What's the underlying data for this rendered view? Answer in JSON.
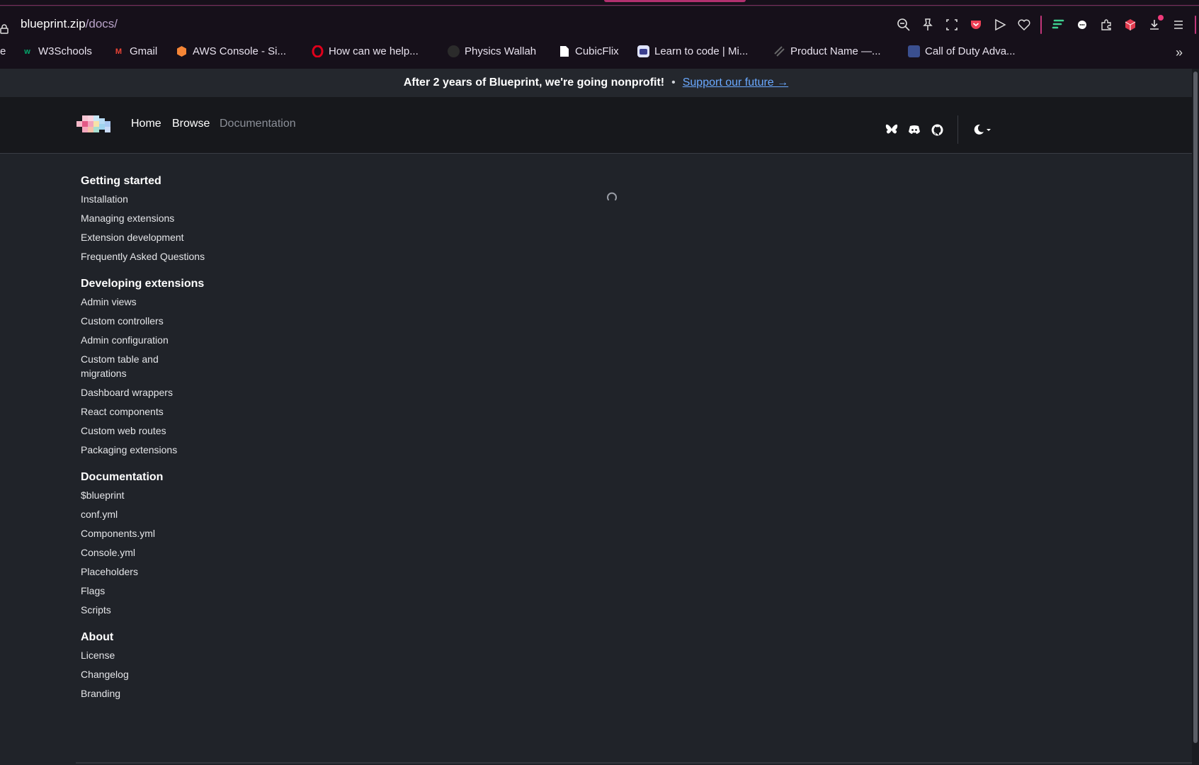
{
  "browser": {
    "url_host": "blueprint.zip",
    "url_path": "/docs/",
    "bookmarks": [
      {
        "label": "e",
        "icon": "none"
      },
      {
        "label": "W3Schools",
        "icon": "w3schools-icon",
        "color": "#04aa6d"
      },
      {
        "label": "Gmail",
        "icon": "gmail-icon",
        "color": "#ea4335"
      },
      {
        "label": "AWS Console - Si...",
        "icon": "aws-icon",
        "color": "#f58536"
      },
      {
        "label": "How can we help...",
        "icon": "opera-icon",
        "color": "#e0001b"
      },
      {
        "label": "Physics Wallah",
        "icon": "physics-wallah-icon",
        "color": "#333333"
      },
      {
        "label": "CubicFlix",
        "icon": "document-icon",
        "color": "#ffffff"
      },
      {
        "label": "Learn to code | Mi...",
        "icon": "mimo-icon",
        "color": "#e0e4ff"
      },
      {
        "label": "Product Name —...",
        "icon": "product-icon",
        "color": "#555555"
      },
      {
        "label": "Call of Duty Adva...",
        "icon": "cod-icon",
        "color": "#5a7bd6"
      }
    ]
  },
  "banner": {
    "message": "After 2 years of Blueprint, we're going nonprofit!",
    "separator": "•",
    "link_label": "Support our future →"
  },
  "nav": {
    "home": "Home",
    "browse": "Browse",
    "documentation": "Documentation"
  },
  "sidebar": {
    "sections": [
      {
        "title": "Getting started",
        "items": [
          "Installation",
          "Managing extensions",
          "Extension development",
          "Frequently Asked Questions"
        ]
      },
      {
        "title": "Developing extensions",
        "items": [
          "Admin views",
          "Custom controllers",
          "Admin configuration",
          "Custom table and migrations",
          "Dashboard wrappers",
          "React components",
          "Custom web routes",
          "Packaging extensions"
        ]
      },
      {
        "title": "Documentation",
        "items": [
          "$blueprint",
          "conf.yml",
          "Components.yml",
          "Console.yml",
          "Placeholders",
          "Flags",
          "Scripts"
        ]
      },
      {
        "title": "About",
        "items": [
          "License",
          "Changelog",
          "Branding"
        ]
      }
    ]
  },
  "colors": {
    "accent_pink": "#c2367a",
    "link_blue": "#6aa9ff",
    "page_bg": "#202329",
    "navbar_bg": "#17181c"
  }
}
